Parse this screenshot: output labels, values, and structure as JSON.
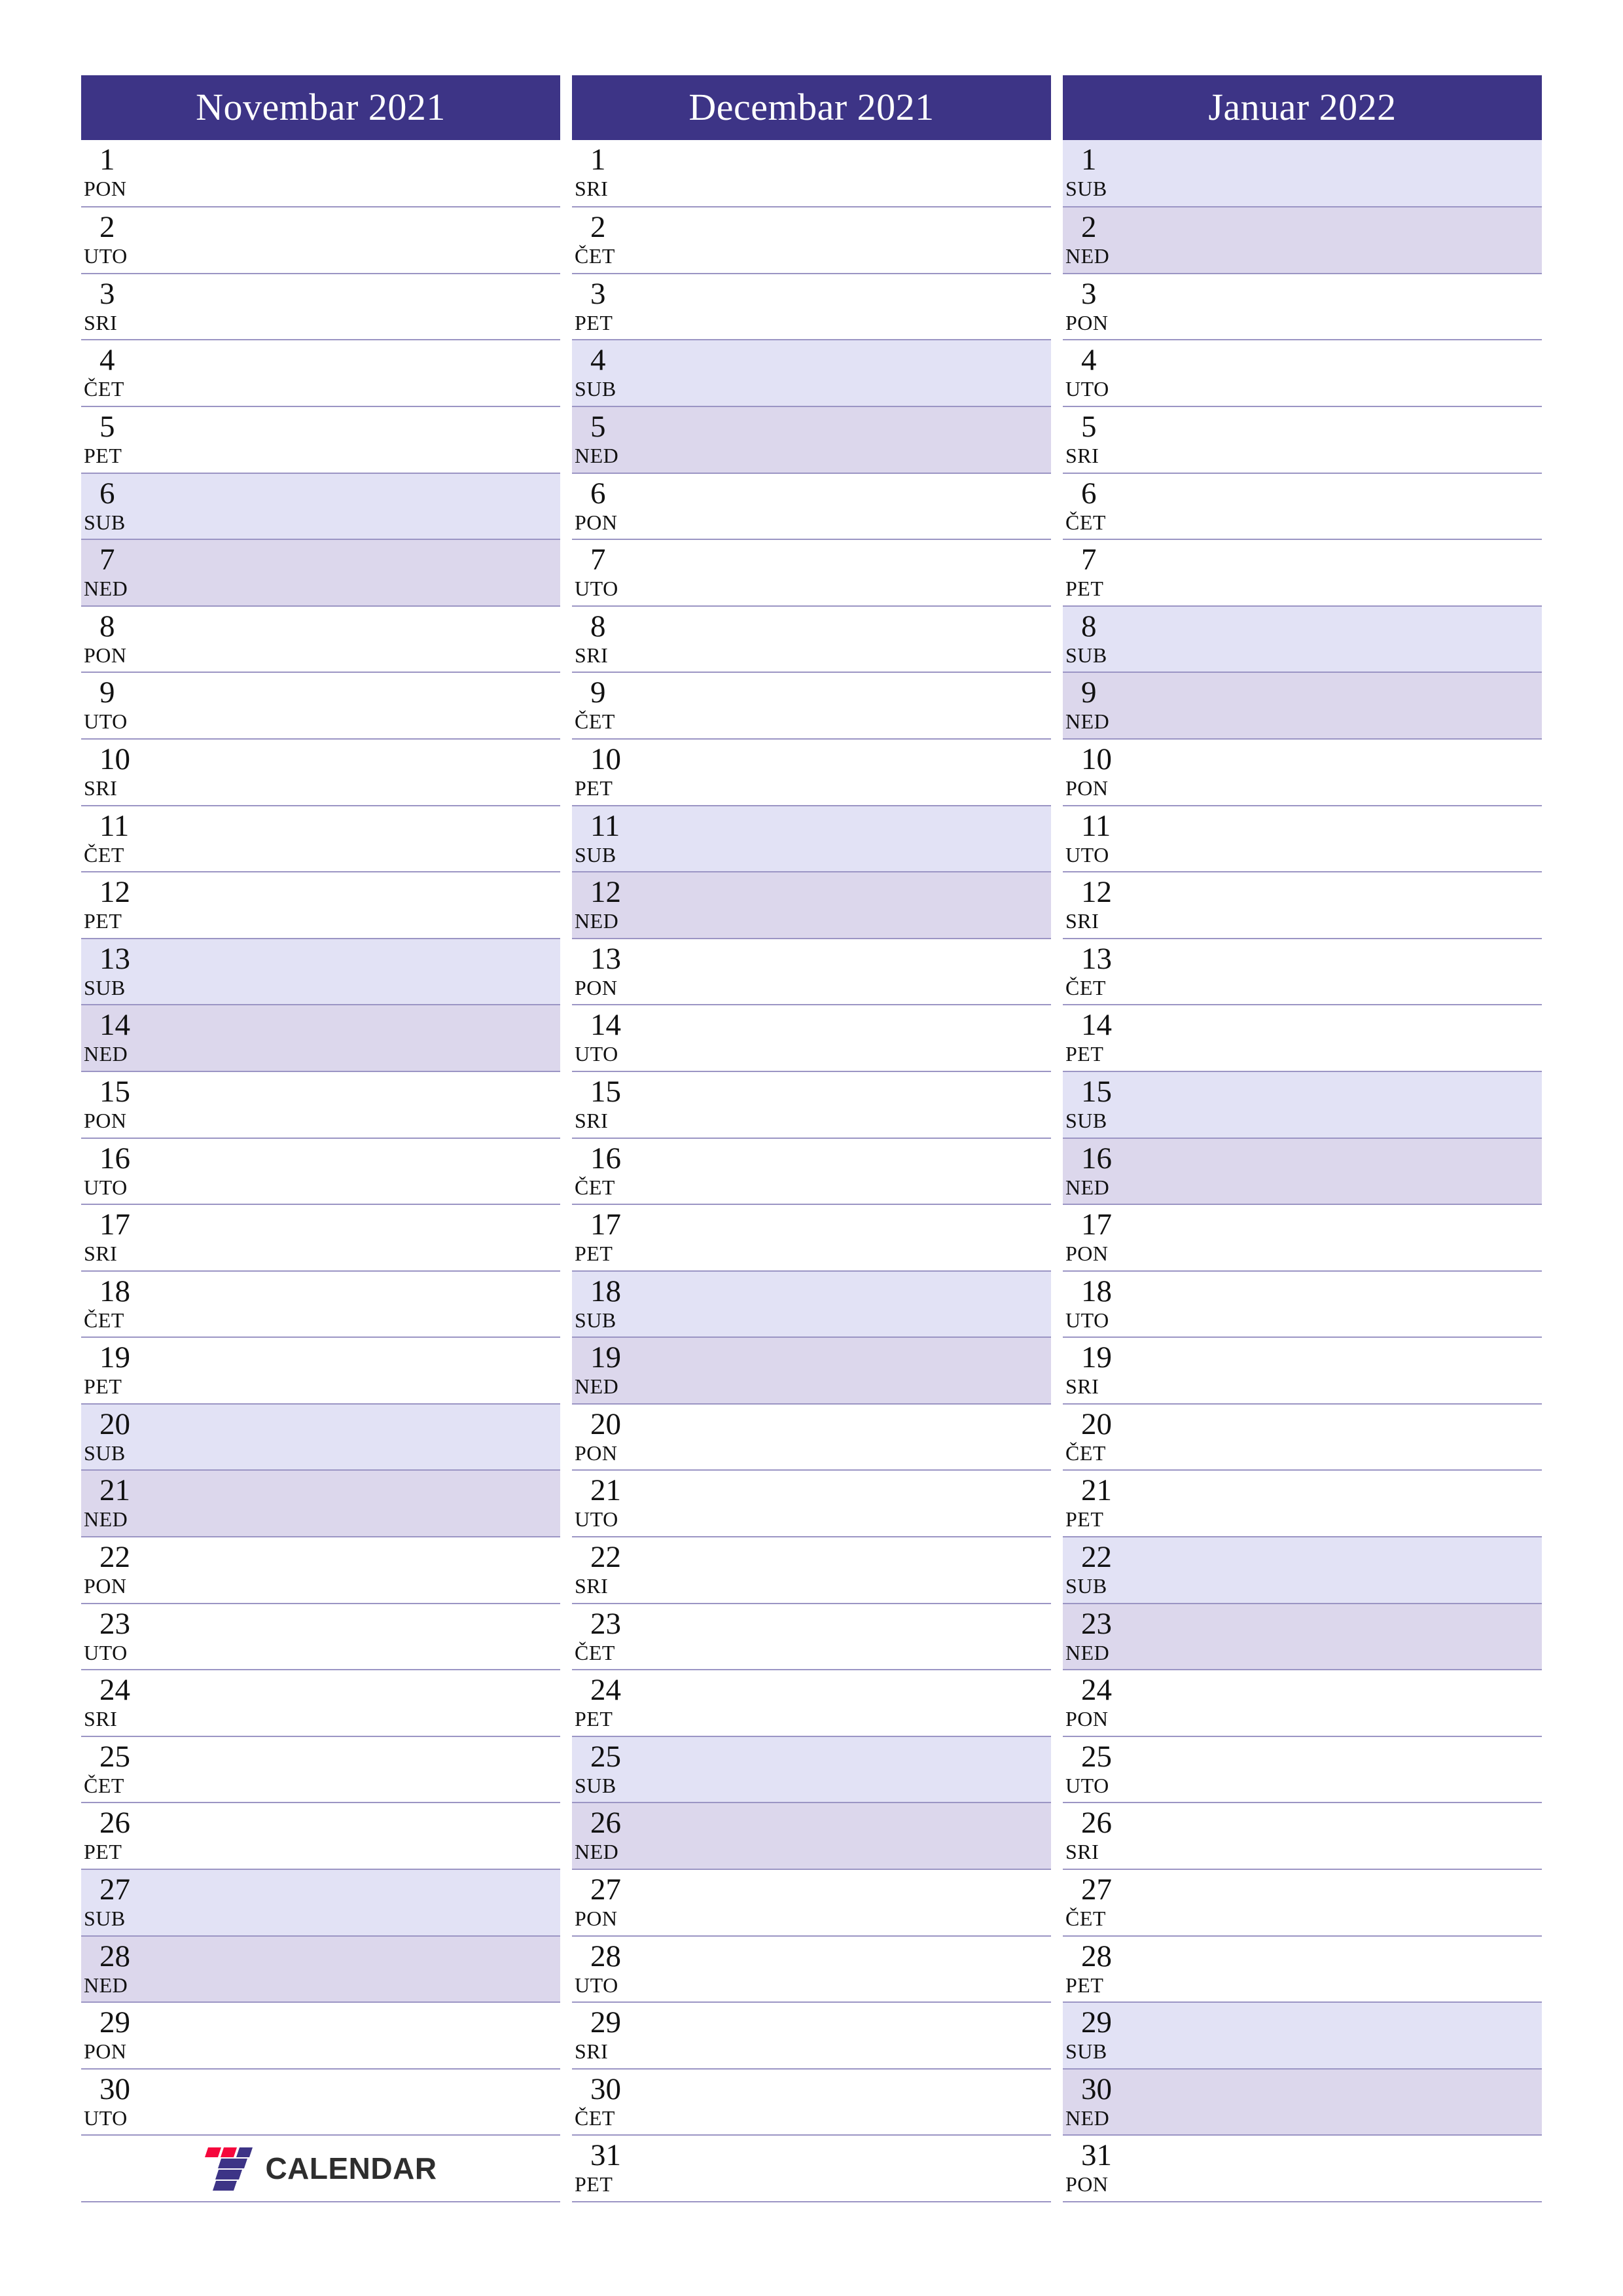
{
  "page": {
    "type": "printable-monthly-planner",
    "language": "sr",
    "orientation": "portrait",
    "columns_count": 3
  },
  "colors": {
    "header_background": "#3D3486",
    "header_text": "#FFFFFF",
    "row_border": "#9B95C4",
    "saturday_background": "#E2E2F5",
    "sunday_background": "#DCD7EC",
    "weekday_background": "#FFFFFF",
    "day_text": "#111111",
    "logo_red": "#F5073C",
    "logo_purple": "#3D3486",
    "logo_text": "#2E2E2E"
  },
  "weekday_labels": {
    "monday": "PON",
    "tuesday": "UTO",
    "wednesday": "SRI",
    "thursday": "ČET",
    "friday": "PET",
    "saturday": "SUB",
    "sunday": "NED"
  },
  "logo": {
    "mark_name": "seven-calendar-logo-mark",
    "text": "CALENDAR"
  },
  "months": [
    {
      "title": "Novembar 2021",
      "year": 2021,
      "month_name": "Novembar",
      "days_count": 30,
      "days": [
        {
          "num": "1",
          "abbr": "PON",
          "kind": "weekday"
        },
        {
          "num": "2",
          "abbr": "UTO",
          "kind": "weekday"
        },
        {
          "num": "3",
          "abbr": "SRI",
          "kind": "weekday"
        },
        {
          "num": "4",
          "abbr": "ČET",
          "kind": "weekday"
        },
        {
          "num": "5",
          "abbr": "PET",
          "kind": "weekday"
        },
        {
          "num": "6",
          "abbr": "SUB",
          "kind": "sat"
        },
        {
          "num": "7",
          "abbr": "NED",
          "kind": "sun"
        },
        {
          "num": "8",
          "abbr": "PON",
          "kind": "weekday"
        },
        {
          "num": "9",
          "abbr": "UTO",
          "kind": "weekday"
        },
        {
          "num": "10",
          "abbr": "SRI",
          "kind": "weekday"
        },
        {
          "num": "11",
          "abbr": "ČET",
          "kind": "weekday"
        },
        {
          "num": "12",
          "abbr": "PET",
          "kind": "weekday"
        },
        {
          "num": "13",
          "abbr": "SUB",
          "kind": "sat"
        },
        {
          "num": "14",
          "abbr": "NED",
          "kind": "sun"
        },
        {
          "num": "15",
          "abbr": "PON",
          "kind": "weekday"
        },
        {
          "num": "16",
          "abbr": "UTO",
          "kind": "weekday"
        },
        {
          "num": "17",
          "abbr": "SRI",
          "kind": "weekday"
        },
        {
          "num": "18",
          "abbr": "ČET",
          "kind": "weekday"
        },
        {
          "num": "19",
          "abbr": "PET",
          "kind": "weekday"
        },
        {
          "num": "20",
          "abbr": "SUB",
          "kind": "sat"
        },
        {
          "num": "21",
          "abbr": "NED",
          "kind": "sun"
        },
        {
          "num": "22",
          "abbr": "PON",
          "kind": "weekday"
        },
        {
          "num": "23",
          "abbr": "UTO",
          "kind": "weekday"
        },
        {
          "num": "24",
          "abbr": "SRI",
          "kind": "weekday"
        },
        {
          "num": "25",
          "abbr": "ČET",
          "kind": "weekday"
        },
        {
          "num": "26",
          "abbr": "PET",
          "kind": "weekday"
        },
        {
          "num": "27",
          "abbr": "SUB",
          "kind": "sat"
        },
        {
          "num": "28",
          "abbr": "NED",
          "kind": "sun"
        },
        {
          "num": "29",
          "abbr": "PON",
          "kind": "weekday"
        },
        {
          "num": "30",
          "abbr": "UTO",
          "kind": "weekday"
        }
      ],
      "has_logo_slot": true
    },
    {
      "title": "Decembar 2021",
      "year": 2021,
      "month_name": "Decembar",
      "days_count": 31,
      "days": [
        {
          "num": "1",
          "abbr": "SRI",
          "kind": "weekday"
        },
        {
          "num": "2",
          "abbr": "ČET",
          "kind": "weekday"
        },
        {
          "num": "3",
          "abbr": "PET",
          "kind": "weekday"
        },
        {
          "num": "4",
          "abbr": "SUB",
          "kind": "sat"
        },
        {
          "num": "5",
          "abbr": "NED",
          "kind": "sun"
        },
        {
          "num": "6",
          "abbr": "PON",
          "kind": "weekday"
        },
        {
          "num": "7",
          "abbr": "UTO",
          "kind": "weekday"
        },
        {
          "num": "8",
          "abbr": "SRI",
          "kind": "weekday"
        },
        {
          "num": "9",
          "abbr": "ČET",
          "kind": "weekday"
        },
        {
          "num": "10",
          "abbr": "PET",
          "kind": "weekday"
        },
        {
          "num": "11",
          "abbr": "SUB",
          "kind": "sat"
        },
        {
          "num": "12",
          "abbr": "NED",
          "kind": "sun"
        },
        {
          "num": "13",
          "abbr": "PON",
          "kind": "weekday"
        },
        {
          "num": "14",
          "abbr": "UTO",
          "kind": "weekday"
        },
        {
          "num": "15",
          "abbr": "SRI",
          "kind": "weekday"
        },
        {
          "num": "16",
          "abbr": "ČET",
          "kind": "weekday"
        },
        {
          "num": "17",
          "abbr": "PET",
          "kind": "weekday"
        },
        {
          "num": "18",
          "abbr": "SUB",
          "kind": "sat"
        },
        {
          "num": "19",
          "abbr": "NED",
          "kind": "sun"
        },
        {
          "num": "20",
          "abbr": "PON",
          "kind": "weekday"
        },
        {
          "num": "21",
          "abbr": "UTO",
          "kind": "weekday"
        },
        {
          "num": "22",
          "abbr": "SRI",
          "kind": "weekday"
        },
        {
          "num": "23",
          "abbr": "ČET",
          "kind": "weekday"
        },
        {
          "num": "24",
          "abbr": "PET",
          "kind": "weekday"
        },
        {
          "num": "25",
          "abbr": "SUB",
          "kind": "sat"
        },
        {
          "num": "26",
          "abbr": "NED",
          "kind": "sun"
        },
        {
          "num": "27",
          "abbr": "PON",
          "kind": "weekday"
        },
        {
          "num": "28",
          "abbr": "UTO",
          "kind": "weekday"
        },
        {
          "num": "29",
          "abbr": "SRI",
          "kind": "weekday"
        },
        {
          "num": "30",
          "abbr": "ČET",
          "kind": "weekday"
        },
        {
          "num": "31",
          "abbr": "PET",
          "kind": "weekday"
        }
      ],
      "has_logo_slot": false
    },
    {
      "title": "Januar 2022",
      "year": 2022,
      "month_name": "Januar",
      "days_count": 31,
      "days": [
        {
          "num": "1",
          "abbr": "SUB",
          "kind": "sat"
        },
        {
          "num": "2",
          "abbr": "NED",
          "kind": "sun"
        },
        {
          "num": "3",
          "abbr": "PON",
          "kind": "weekday"
        },
        {
          "num": "4",
          "abbr": "UTO",
          "kind": "weekday"
        },
        {
          "num": "5",
          "abbr": "SRI",
          "kind": "weekday"
        },
        {
          "num": "6",
          "abbr": "ČET",
          "kind": "weekday"
        },
        {
          "num": "7",
          "abbr": "PET",
          "kind": "weekday"
        },
        {
          "num": "8",
          "abbr": "SUB",
          "kind": "sat"
        },
        {
          "num": "9",
          "abbr": "NED",
          "kind": "sun"
        },
        {
          "num": "10",
          "abbr": "PON",
          "kind": "weekday"
        },
        {
          "num": "11",
          "abbr": "UTO",
          "kind": "weekday"
        },
        {
          "num": "12",
          "abbr": "SRI",
          "kind": "weekday"
        },
        {
          "num": "13",
          "abbr": "ČET",
          "kind": "weekday"
        },
        {
          "num": "14",
          "abbr": "PET",
          "kind": "weekday"
        },
        {
          "num": "15",
          "abbr": "SUB",
          "kind": "sat"
        },
        {
          "num": "16",
          "abbr": "NED",
          "kind": "sun"
        },
        {
          "num": "17",
          "abbr": "PON",
          "kind": "weekday"
        },
        {
          "num": "18",
          "abbr": "UTO",
          "kind": "weekday"
        },
        {
          "num": "19",
          "abbr": "SRI",
          "kind": "weekday"
        },
        {
          "num": "20",
          "abbr": "ČET",
          "kind": "weekday"
        },
        {
          "num": "21",
          "abbr": "PET",
          "kind": "weekday"
        },
        {
          "num": "22",
          "abbr": "SUB",
          "kind": "sat"
        },
        {
          "num": "23",
          "abbr": "NED",
          "kind": "sun"
        },
        {
          "num": "24",
          "abbr": "PON",
          "kind": "weekday"
        },
        {
          "num": "25",
          "abbr": "UTO",
          "kind": "weekday"
        },
        {
          "num": "26",
          "abbr": "SRI",
          "kind": "weekday"
        },
        {
          "num": "27",
          "abbr": "ČET",
          "kind": "weekday"
        },
        {
          "num": "28",
          "abbr": "PET",
          "kind": "weekday"
        },
        {
          "num": "29",
          "abbr": "SUB",
          "kind": "sat"
        },
        {
          "num": "30",
          "abbr": "NED",
          "kind": "sun"
        },
        {
          "num": "31",
          "abbr": "PON",
          "kind": "weekday"
        }
      ],
      "has_logo_slot": false
    }
  ]
}
